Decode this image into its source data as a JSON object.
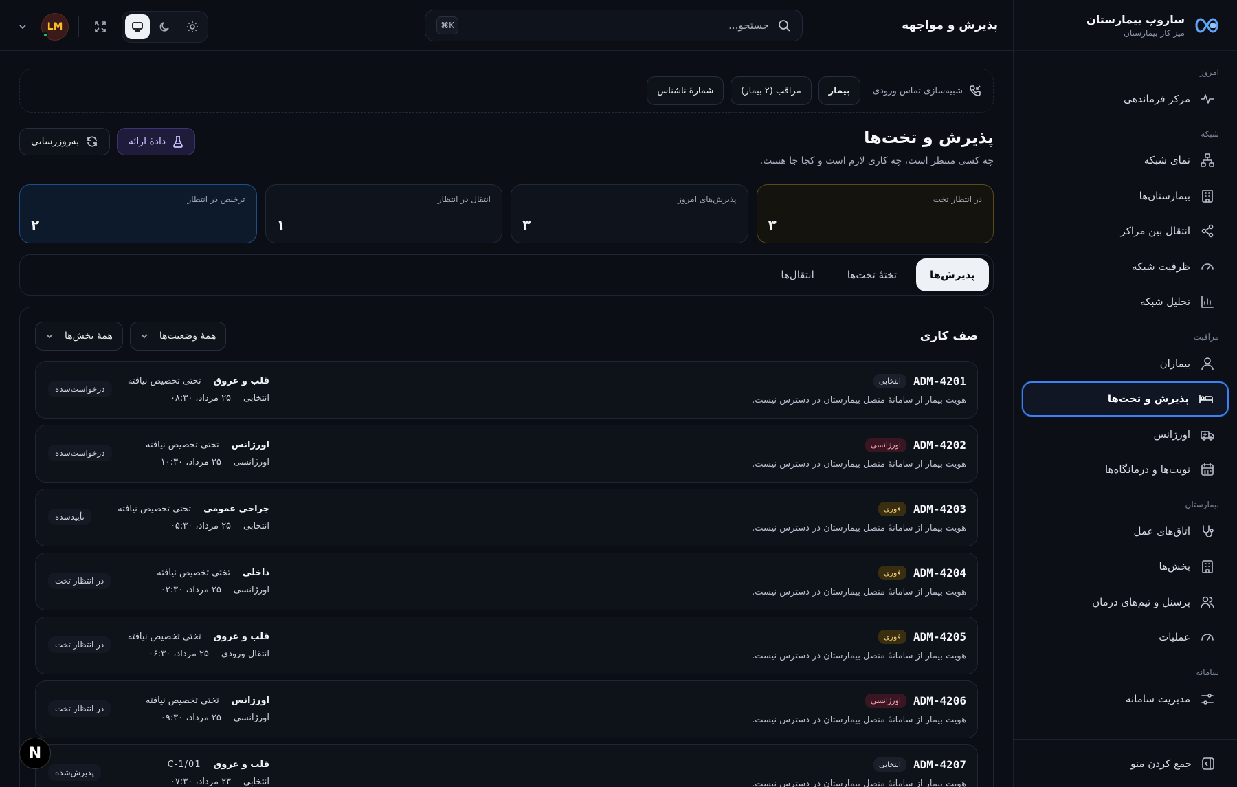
{
  "brand": {
    "name": "ساروپ بیمارستان",
    "subtitle": "میز کار بیمارستان"
  },
  "sidebar": {
    "sections": [
      {
        "label": "امروز",
        "items": [
          {
            "label": "مرکز فرماندهی",
            "icon": "activity-icon"
          }
        ]
      },
      {
        "label": "شبکه",
        "items": [
          {
            "label": "نمای شبکه",
            "icon": "network-icon"
          },
          {
            "label": "بیمارستان‌ها",
            "icon": "building-icon"
          },
          {
            "label": "انتقال بین مراکز",
            "icon": "share-icon"
          },
          {
            "label": "ظرفیت شبکه",
            "icon": "gauge-icon"
          },
          {
            "label": "تحلیل شبکه",
            "icon": "bar-chart-icon"
          }
        ]
      },
      {
        "label": "مراقبت",
        "items": [
          {
            "label": "بیماران",
            "icon": "user-icon"
          },
          {
            "label": "پذیرش و تخت‌ها",
            "icon": "bed-icon",
            "active": true
          },
          {
            "label": "اورژانس",
            "icon": "ambulance-icon"
          },
          {
            "label": "نوبت‌ها و درمانگاه‌ها",
            "icon": "calendar-icon"
          }
        ]
      },
      {
        "label": "بیمارستان",
        "items": [
          {
            "label": "اتاق‌های عمل",
            "icon": "stethoscope-icon"
          },
          {
            "label": "بخش‌ها",
            "icon": "building-icon"
          },
          {
            "label": "پرسنل و تیم‌های درمان",
            "icon": "users-icon"
          },
          {
            "label": "عملیات",
            "icon": "gauge-icon"
          }
        ]
      },
      {
        "label": "سامانه",
        "items": [
          {
            "label": "مدیریت سامانه",
            "icon": "sliders-icon"
          }
        ]
      }
    ],
    "collapse_label": "جمع کردن منو"
  },
  "topbar": {
    "title": "پذیرش و مواجهه",
    "search_placeholder": "جستجو...",
    "shortcut": "⌘K",
    "avatar_initials": "LM"
  },
  "simulation": {
    "label": "شبیه‌سازی تماس ورودی",
    "chips": [
      "بیمار",
      "مراقب (۲ بیمار)",
      "شمارهٔ ناشناس"
    ]
  },
  "page": {
    "title": "پذیرش و تخت‌ها",
    "subtitle": "چه کسی منتظر است، چه کاری لازم است و کجا جا هست.",
    "demo_button": "دادهٔ ارائه",
    "refresh_button": "به‌روزرسانی"
  },
  "stats": [
    {
      "label": "در انتظار تخت",
      "value": "۳"
    },
    {
      "label": "پذیرش‌های امروز",
      "value": "۳"
    },
    {
      "label": "انتقال در انتظار",
      "value": "۱"
    },
    {
      "label": "ترخیص در انتظار",
      "value": "۲"
    }
  ],
  "tabs": [
    "پذیرش‌ها",
    "تختهٔ تخت‌ها",
    "انتقال‌ها"
  ],
  "queue": {
    "title": "صف کاری",
    "filter_status": "همهٔ وضعیت‌ها",
    "filter_ward": "همهٔ بخش‌ها",
    "rows": [
      {
        "id": "ADM-4201",
        "badge": "انتخابی",
        "note": "هویت بیمار از سامانهٔ متصل بیمارستان در دسترس نیست.",
        "dept": "قلب و عروق",
        "bed": "تختی تخصیص نیافته",
        "source": "انتخابی",
        "time": "۲۵ مرداد، ۰۸:۳۰",
        "status": "درخواست‌شده"
      },
      {
        "id": "ADM-4202",
        "badge": "اورژانسی",
        "note": "هویت بیمار از سامانهٔ متصل بیمارستان در دسترس نیست.",
        "dept": "اورژانس",
        "bed": "تختی تخصیص نیافته",
        "source": "اورژانسی",
        "time": "۲۵ مرداد، ۱۰:۳۰",
        "status": "درخواست‌شده"
      },
      {
        "id": "ADM-4203",
        "badge": "فوری",
        "note": "هویت بیمار از سامانهٔ متصل بیمارستان در دسترس نیست.",
        "dept": "جراحی عمومی",
        "bed": "تختی تخصیص نیافته",
        "source": "انتخابی",
        "time": "۲۵ مرداد، ۰۵:۳۰",
        "status": "تأییدشده"
      },
      {
        "id": "ADM-4204",
        "badge": "فوری",
        "note": "هویت بیمار از سامانهٔ متصل بیمارستان در دسترس نیست.",
        "dept": "داخلی",
        "bed": "تختی تخصیص نیافته",
        "source": "اورژانسی",
        "time": "۲۵ مرداد، ۰۲:۳۰",
        "status": "در انتظار تخت"
      },
      {
        "id": "ADM-4205",
        "badge": "فوری",
        "note": "هویت بیمار از سامانهٔ متصل بیمارستان در دسترس نیست.",
        "dept": "قلب و عروق",
        "bed": "تختی تخصیص نیافته",
        "source": "انتقال ورودی",
        "time": "۲۵ مرداد، ۰۶:۳۰",
        "status": "در انتظار تخت"
      },
      {
        "id": "ADM-4206",
        "badge": "اورژانسی",
        "note": "هویت بیمار از سامانهٔ متصل بیمارستان در دسترس نیست.",
        "dept": "اورژانس",
        "bed": "تختی تخصیص نیافته",
        "source": "اورژانسی",
        "time": "۲۵ مرداد، ۰۹:۳۰",
        "status": "در انتظار تخت"
      },
      {
        "id": "ADM-4207",
        "badge": "انتخابی",
        "note": "هویت بیمار از سامانهٔ متصل بیمارستان در دسترس نیست.",
        "dept": "قلب و عروق",
        "bed": "C-1/01",
        "source": "انتخابی",
        "time": "۲۳ مرداد، ۰۷:۳۰",
        "status": "پذیرش‌شده"
      }
    ]
  },
  "fab_label": "N"
}
